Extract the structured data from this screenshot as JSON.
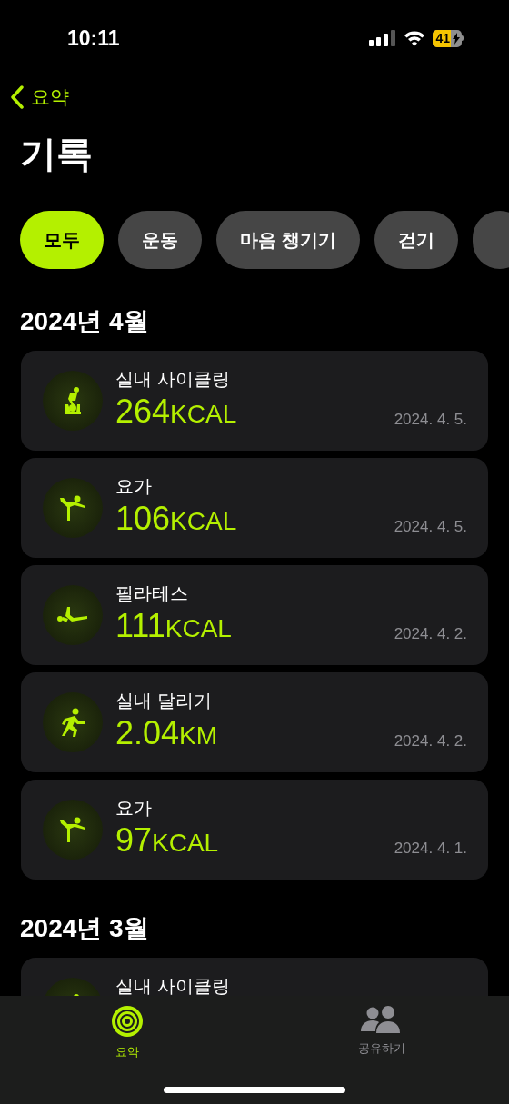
{
  "status_bar": {
    "time": "10:11",
    "battery": "41"
  },
  "nav": {
    "back": "요약"
  },
  "title": "기록",
  "filters": [
    {
      "label": "모두",
      "selected": true
    },
    {
      "label": "운동",
      "selected": false
    },
    {
      "label": "마음 챙기기",
      "selected": false
    },
    {
      "label": "걷기",
      "selected": false
    }
  ],
  "sections": [
    {
      "heading": "2024년 4월",
      "workouts": [
        {
          "kind": "cycling",
          "name": "실내 사이클링",
          "value": "264",
          "unit": "KCAL",
          "date": "2024. 4. 5."
        },
        {
          "kind": "yoga",
          "name": "요가",
          "value": "106",
          "unit": "KCAL",
          "date": "2024. 4. 5."
        },
        {
          "kind": "pilates",
          "name": "필라테스",
          "value": "111",
          "unit": "KCAL",
          "date": "2024. 4. 2."
        },
        {
          "kind": "running",
          "name": "실내 달리기",
          "value": "2.04",
          "unit": "KM",
          "date": "2024. 4. 2."
        },
        {
          "kind": "yoga",
          "name": "요가",
          "value": "97",
          "unit": "KCAL",
          "date": "2024. 4. 1."
        }
      ]
    },
    {
      "heading": "2024년 3월",
      "workouts": [
        {
          "kind": "cycling",
          "name": "실내 사이클링"
        }
      ]
    }
  ],
  "tab_bar": [
    {
      "kind": "summary",
      "label": "요약",
      "selected": true
    },
    {
      "kind": "sharing",
      "label": "공유하기",
      "selected": false
    }
  ]
}
